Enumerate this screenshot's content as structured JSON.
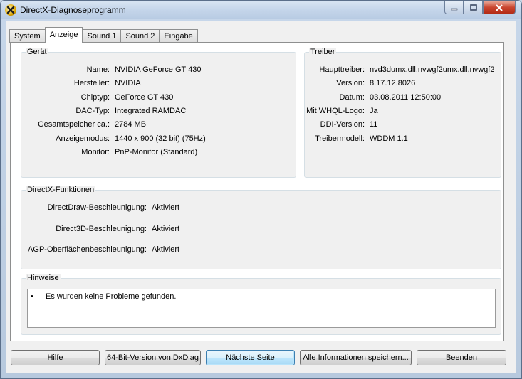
{
  "window": {
    "title": "DirectX-Diagnoseprogramm"
  },
  "tabs": [
    "System",
    "Anzeige",
    "Sound 1",
    "Sound 2",
    "Eingabe"
  ],
  "active_tab": "Anzeige",
  "device": {
    "title": "Gerät",
    "fields": [
      {
        "label": "Name:",
        "value": "NVIDIA GeForce GT 430"
      },
      {
        "label": "Hersteller:",
        "value": "NVIDIA"
      },
      {
        "label": "Chiptyp:",
        "value": "GeForce GT 430"
      },
      {
        "label": "DAC-Typ:",
        "value": "Integrated RAMDAC"
      },
      {
        "label": "Gesamtspeicher ca.:",
        "value": "2784 MB"
      },
      {
        "label": "Anzeigemodus:",
        "value": "1440 x 900 (32 bit) (75Hz)"
      },
      {
        "label": "Monitor:",
        "value": "PnP-Monitor (Standard)"
      }
    ]
  },
  "driver": {
    "title": "Treiber",
    "fields": [
      {
        "label": "Haupttreiber:",
        "value": "nvd3dumx.dll,nvwgf2umx.dll,nvwgf2"
      },
      {
        "label": "Version:",
        "value": "8.17.12.8026"
      },
      {
        "label": "Datum:",
        "value": "03.08.2011 12:50:00"
      },
      {
        "label": "Mit WHQL-Logo:",
        "value": "Ja"
      },
      {
        "label": "DDI-Version:",
        "value": "11"
      },
      {
        "label": "Treibermodell:",
        "value": "WDDM 1.1"
      }
    ]
  },
  "directx": {
    "title": "DirectX-Funktionen",
    "fields": [
      {
        "label": "DirectDraw-Beschleunigung:",
        "value": "Aktiviert"
      },
      {
        "label": "Direct3D-Beschleunigung:",
        "value": "Aktiviert"
      },
      {
        "label": "AGP-Oberflächenbeschleunigung:",
        "value": "Aktiviert"
      }
    ]
  },
  "notes": {
    "title": "Hinweise",
    "bullet": "•",
    "items": [
      "Es wurden keine Probleme gefunden."
    ]
  },
  "buttons": {
    "help": "Hilfe",
    "x64": "64-Bit-Version von DxDiag",
    "next": "Nächste Seite",
    "save": "Alle Informationen speichern...",
    "exit": "Beenden"
  },
  "icons": {
    "app": "directx-icon",
    "minimize": "minimize-icon",
    "maximize": "maximize-icon",
    "close": "close-icon"
  }
}
